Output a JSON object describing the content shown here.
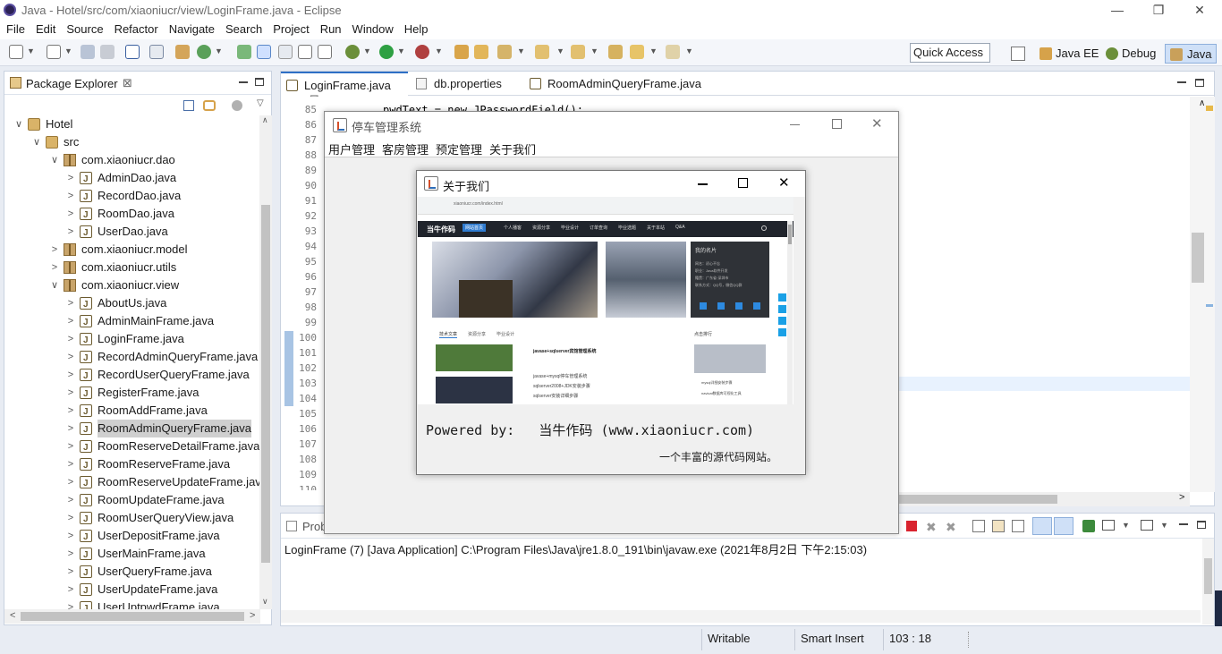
{
  "window": {
    "title": "Java - Hotel/src/com/xiaoniucr/view/LoginFrame.java - Eclipse",
    "minimize": "—",
    "restore": "❐",
    "close": "✕"
  },
  "menu": [
    "File",
    "Edit",
    "Source",
    "Refactor",
    "Navigate",
    "Search",
    "Project",
    "Run",
    "Window",
    "Help"
  ],
  "toolbar": {
    "quick_access": "Quick Access",
    "perspectives": [
      "Java EE",
      "Debug",
      "Java"
    ]
  },
  "package_explorer": {
    "title": "Package Explorer",
    "close": "⊠",
    "tree": [
      {
        "label": "Hotel",
        "level": 0,
        "chev": "∨",
        "type": "project"
      },
      {
        "label": "src",
        "level": 1,
        "chev": "∨",
        "type": "src"
      },
      {
        "label": "com.xiaoniucr.dao",
        "level": 2,
        "chev": "∨",
        "type": "package"
      },
      {
        "label": "AdminDao.java",
        "level": 3,
        "chev": ">",
        "type": "file"
      },
      {
        "label": "RecordDao.java",
        "level": 3,
        "chev": ">",
        "type": "file"
      },
      {
        "label": "RoomDao.java",
        "level": 3,
        "chev": ">",
        "type": "file"
      },
      {
        "label": "UserDao.java",
        "level": 3,
        "chev": ">",
        "type": "file"
      },
      {
        "label": "com.xiaoniucr.model",
        "level": 2,
        "chev": ">",
        "type": "package"
      },
      {
        "label": "com.xiaoniucr.utils",
        "level": 2,
        "chev": ">",
        "type": "package"
      },
      {
        "label": "com.xiaoniucr.view",
        "level": 2,
        "chev": "∨",
        "type": "package"
      },
      {
        "label": "AboutUs.java",
        "level": 3,
        "chev": ">",
        "type": "file"
      },
      {
        "label": "AdminMainFrame.java",
        "level": 3,
        "chev": ">",
        "type": "file"
      },
      {
        "label": "LoginFrame.java",
        "level": 3,
        "chev": ">",
        "type": "file"
      },
      {
        "label": "RecordAdminQueryFrame.java",
        "level": 3,
        "chev": ">",
        "type": "file"
      },
      {
        "label": "RecordUserQueryFrame.java",
        "level": 3,
        "chev": ">",
        "type": "file"
      },
      {
        "label": "RegisterFrame.java",
        "level": 3,
        "chev": ">",
        "type": "file"
      },
      {
        "label": "RoomAddFrame.java",
        "level": 3,
        "chev": ">",
        "type": "file"
      },
      {
        "label": "RoomAdminQueryFrame.java",
        "level": 3,
        "chev": ">",
        "type": "file",
        "selected": true
      },
      {
        "label": "RoomReserveDetailFrame.java",
        "level": 3,
        "chev": ">",
        "type": "file"
      },
      {
        "label": "RoomReserveFrame.java",
        "level": 3,
        "chev": ">",
        "type": "file"
      },
      {
        "label": "RoomReserveUpdateFrame.java",
        "level": 3,
        "chev": ">",
        "type": "file"
      },
      {
        "label": "RoomUpdateFrame.java",
        "level": 3,
        "chev": ">",
        "type": "file"
      },
      {
        "label": "RoomUserQueryView.java",
        "level": 3,
        "chev": ">",
        "type": "file"
      },
      {
        "label": "UserDepositFrame.java",
        "level": 3,
        "chev": ">",
        "type": "file"
      },
      {
        "label": "UserMainFrame.java",
        "level": 3,
        "chev": ">",
        "type": "file"
      },
      {
        "label": "UserQueryFrame.java",
        "level": 3,
        "chev": ">",
        "type": "file"
      },
      {
        "label": "UserUpdateFrame.java",
        "level": 3,
        "chev": ">",
        "type": "file"
      },
      {
        "label": "UserUptpwdFrame.java",
        "level": 3,
        "chev": ">",
        "type": "file"
      }
    ]
  },
  "editor": {
    "tabs": [
      "LoginFrame.java",
      "db.properties",
      "RoomAdminQueryFrame.java"
    ],
    "close": "⊠",
    "line_numbers": [
      "85",
      "86",
      "87",
      "88",
      "89",
      "90",
      "91",
      "92",
      "93",
      "94",
      "95",
      "96",
      "97",
      "98",
      "99",
      "100",
      "101",
      "102",
      "103",
      "104",
      "105",
      "106",
      "107",
      "108",
      "109",
      "110"
    ],
    "code_line": "pwdText = new JPasswordField();"
  },
  "console": {
    "tab": "Prob",
    "text": "LoginFrame (7) [Java Application] C:\\Program Files\\Java\\jre1.8.0_191\\bin\\javaw.exe (2021年8月2日 下午2:15:03)"
  },
  "status": {
    "writable": "Writable",
    "insert": "Smart Insert",
    "position": "103 : 18"
  },
  "app_window": {
    "title": "停车管理系统",
    "menu": [
      "用户管理",
      "客房管理",
      "预定管理",
      "关于我们"
    ]
  },
  "about_dialog": {
    "title": "关于我们",
    "powered": "Powered by:   当牛作码 (www.xiaoniucr.com)",
    "slogan": "一个丰富的源代码网站。",
    "website": {
      "url": "xiaoniucr.com/index.html",
      "brand": "当牛作码",
      "nav": [
        "网站首页",
        "个人播客",
        "资源分享",
        "毕业设计",
        "订单查询",
        "毕业选题",
        "关于本站",
        "Q&A"
      ],
      "card_title": "我的名片",
      "card_lines": [
        "网名：初心不忘",
        "职业：Java软件开发",
        "籍贯：广东省·深圳市",
        "联系方式：QQ号，微信QQ群"
      ],
      "tabs": [
        "技术文章",
        "资源分享",
        "毕业设计"
      ],
      "article_title": "javase+sqlserver宾馆管理系统",
      "list": [
        "javase+mysql停车管理系统",
        "sqlserver2008+JDK安装步骤",
        "sqlserver安装详细步骤"
      ],
      "rank_title": "点击排行",
      "rank": [
        "mysql详细安装步骤",
        "navicat数据库可视化工具"
      ]
    }
  },
  "colors": {
    "accent": "#2e6fc5",
    "selected": "#cfcfcf",
    "site_dark": "#20242c"
  }
}
